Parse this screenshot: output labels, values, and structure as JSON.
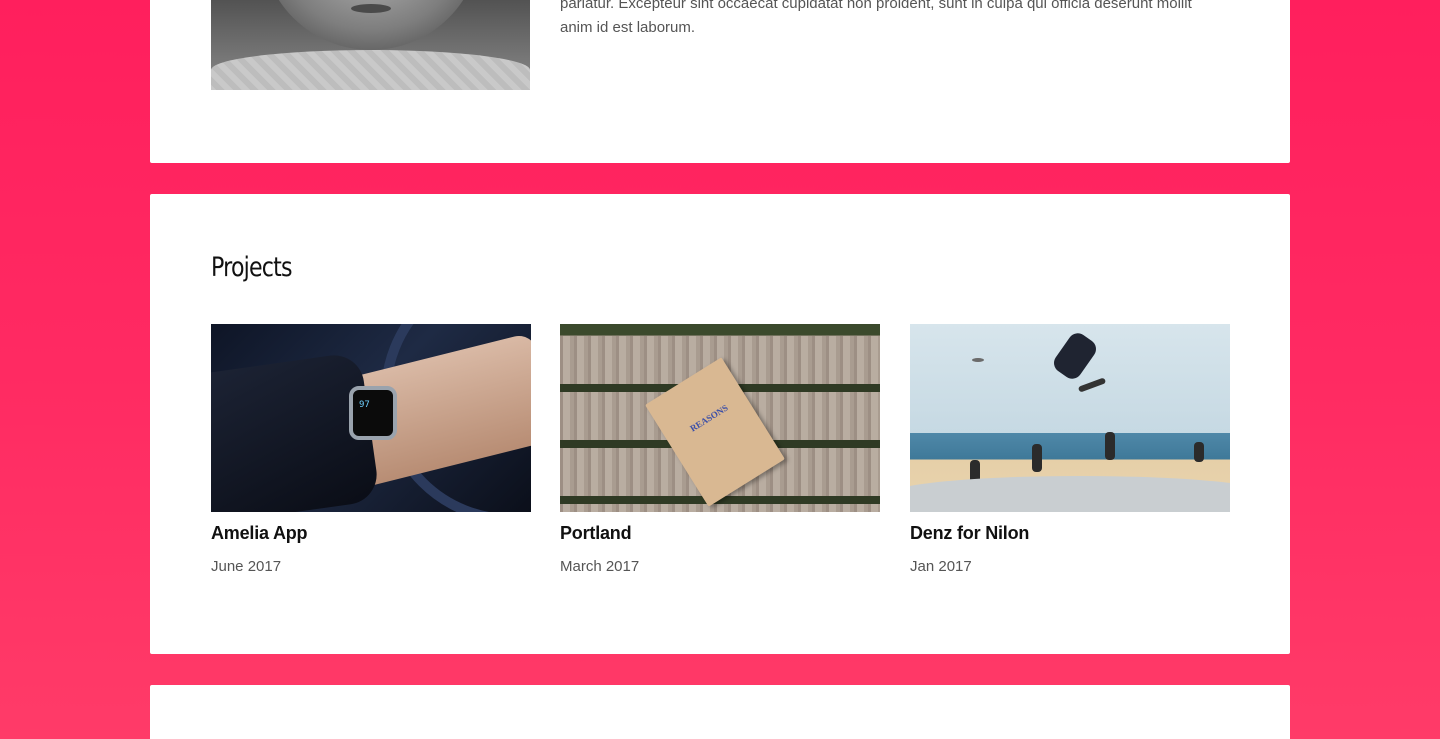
{
  "about": {
    "bio_line1": "pariatur. Excepteur sint occaecat cupidatat non proident, sunt in culpa qui officia deserunt mollit",
    "bio_line2": "anim id est laborum."
  },
  "projects": {
    "title": "Projects",
    "items": [
      {
        "name": "Amelia App",
        "date": "June 2017"
      },
      {
        "name": "Portland",
        "date": "March 2017"
      },
      {
        "name": "Denz for Nilon",
        "date": "Jan 2017"
      }
    ],
    "watch_screen_text": "97",
    "card_text": "REASONS"
  },
  "colors": {
    "background_top": "#ff1f5d",
    "background_bottom": "#ff3b68",
    "card": "#ffffff",
    "heading": "#111111",
    "body_text": "#555555"
  }
}
